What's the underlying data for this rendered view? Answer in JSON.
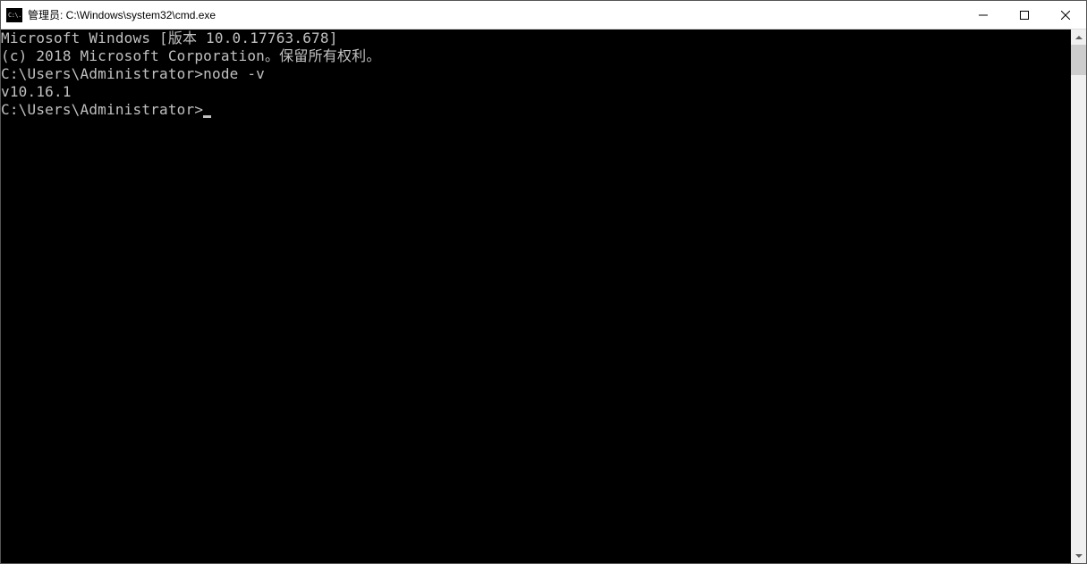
{
  "window": {
    "title": "管理员: C:\\Windows\\system32\\cmd.exe",
    "icon_text": "C:\\."
  },
  "console": {
    "line1": "Microsoft Windows [版本 10.0.17763.678]",
    "line2": "(c) 2018 Microsoft Corporation。保留所有权利。",
    "blank1": "",
    "prompt1_path": "C:\\Users\\Administrator>",
    "prompt1_cmd": "node -v",
    "output1": "v10.16.1",
    "blank2": "",
    "prompt2_path": "C:\\Users\\Administrator>"
  }
}
